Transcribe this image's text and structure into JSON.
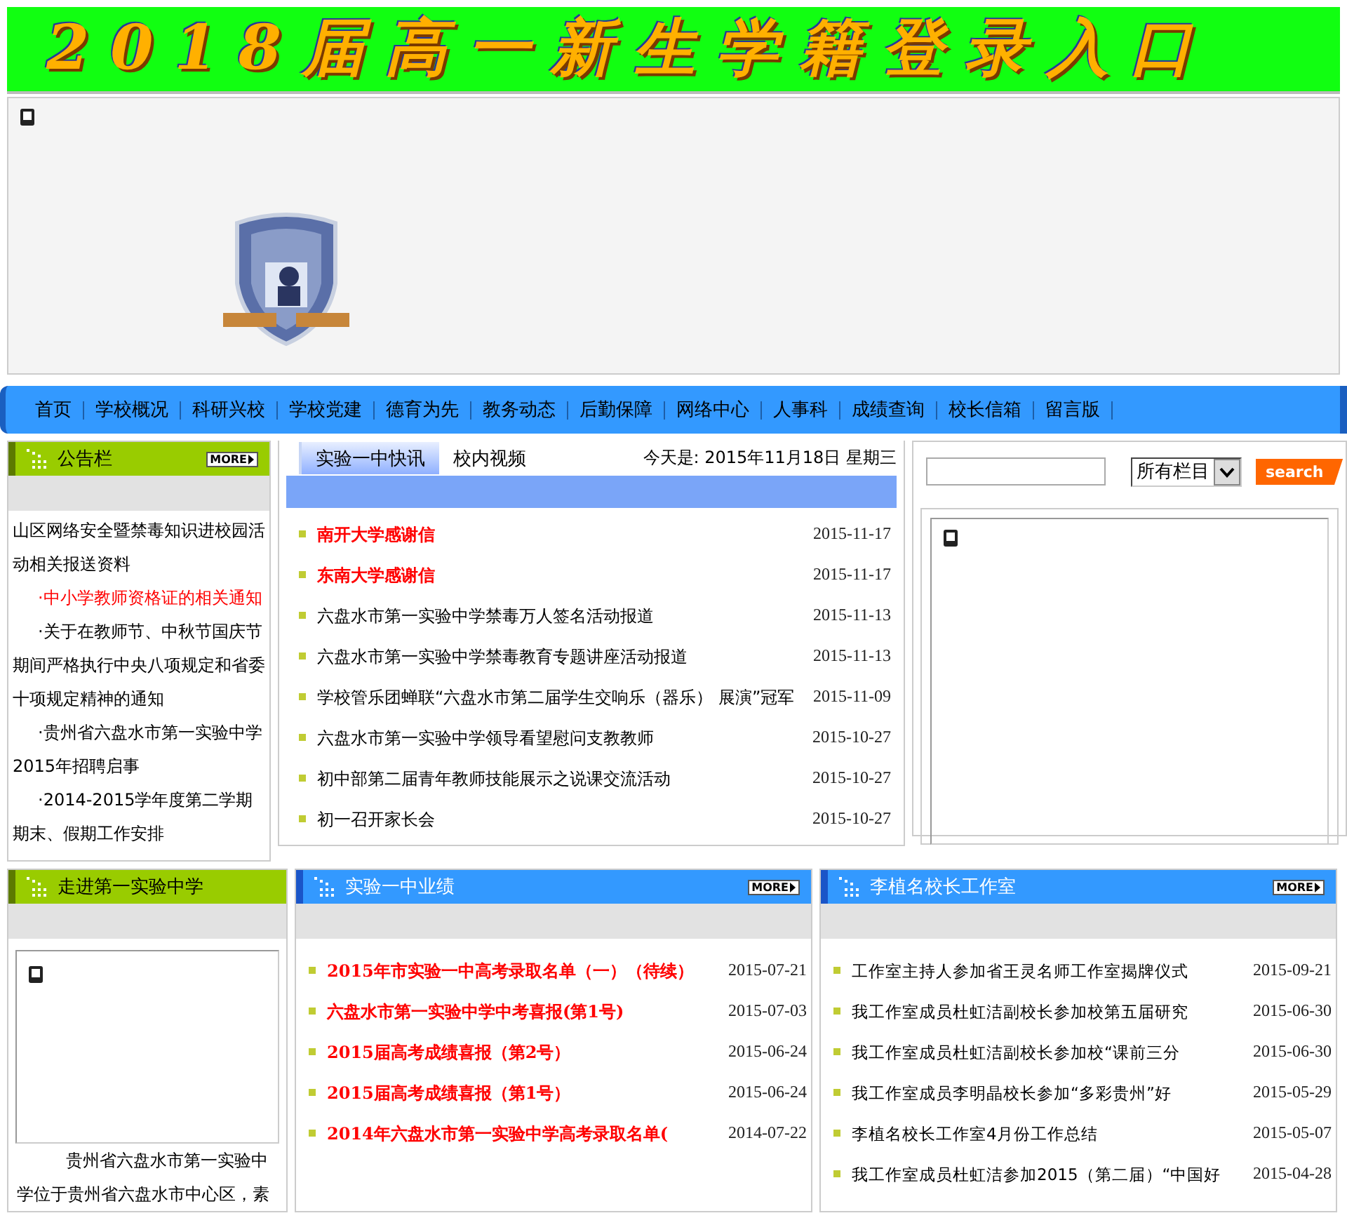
{
  "banner": {
    "title": "2018届高一新生学籍登录入口"
  },
  "nav": [
    "首页",
    "学校概况",
    "科研兴校",
    "学校党建",
    "德育为先",
    "教务动态",
    "后勤保障",
    "网络中心",
    "人事科",
    "成绩查询",
    "校长信箱",
    "留言版"
  ],
  "notice": {
    "title": "公告栏",
    "more": "MORE",
    "items": [
      {
        "text": "山区网络安全暨禁毒知识进校园活动相关报送资料",
        "highlighted": false
      },
      {
        "text": "·中小学教师资格证的相关通知",
        "highlighted": true
      },
      {
        "text": "·关于在教师节、中秋节国庆节期间严格执行中央八项规定和省委十项规定精神的通知",
        "highlighted": false
      },
      {
        "text": "·贵州省六盘水市第一实验中学2015年招聘启事",
        "highlighted": false
      },
      {
        "text": "·2014-2015学年度第二学期期末、假期工作安排",
        "highlighted": false
      }
    ]
  },
  "news": {
    "tabs": [
      {
        "label": "实验一中快讯",
        "selected": true
      },
      {
        "label": "校内视频",
        "selected": false
      }
    ],
    "today": "今天是: 2015年11月18日  星期三",
    "items": [
      {
        "title": "南开大学感谢信",
        "date": "2015-11-17",
        "highlighted": true
      },
      {
        "title": "东南大学感谢信",
        "date": "2015-11-17",
        "highlighted": true
      },
      {
        "title": "六盘水市第一实验中学禁毒万人签名活动报道",
        "date": "2015-11-13",
        "highlighted": false
      },
      {
        "title": "六盘水市第一实验中学禁毒教育专题讲座活动报道",
        "date": "2015-11-13",
        "highlighted": false
      },
      {
        "title": "学校管乐团蝉联“六盘水市第二届学生交响乐（器乐） 展演”冠军",
        "date": "2015-11-09",
        "highlighted": false
      },
      {
        "title": "六盘水市第一实验中学领导看望慰问支教教师",
        "date": "2015-10-27",
        "highlighted": false
      },
      {
        "title": "初中部第二届青年教师技能展示之说课交流活动",
        "date": "2015-10-27",
        "highlighted": false
      },
      {
        "title": "初一召开家长会",
        "date": "2015-10-27",
        "highlighted": false
      }
    ]
  },
  "search": {
    "select": "所有栏目",
    "button": "search"
  },
  "about": {
    "title": "走进第一实验中学",
    "text": "贵州省六盘水市第一实验中学位于贵州省六盘水市中心区，素"
  },
  "achievements": {
    "title": "实验一中业绩",
    "more": "MORE",
    "items": [
      {
        "title": "2015年市实验一中高考录取名单（一）（待续）",
        "date": "2015-07-21",
        "highlighted": true
      },
      {
        "title": "六盘水市第一实验中学中考喜报(第1号)",
        "date": "2015-07-03",
        "highlighted": true
      },
      {
        "title": "2015届高考成绩喜报（第2号）",
        "date": "2015-06-24",
        "highlighted": true
      },
      {
        "title": "2015届高考成绩喜报（第1号）",
        "date": "2015-06-24",
        "highlighted": true
      },
      {
        "title": "2014年六盘水市第一实验中学高考录取名单(",
        "date": "2014-07-22",
        "highlighted": true
      }
    ]
  },
  "studio": {
    "title": "李植名校长工作室",
    "more": "MORE",
    "items": [
      {
        "title": "工作室主持人参加省王灵名师工作室揭牌仪式",
        "date": "2015-09-21",
        "highlighted": false
      },
      {
        "title": "我工作室成员杜虹洁副校长参加校第五届研究",
        "date": "2015-06-30",
        "highlighted": false
      },
      {
        "title": "我工作室成员杜虹洁副校长参加校“课前三分",
        "date": "2015-06-30",
        "highlighted": false
      },
      {
        "title": "我工作室成员李明晶校长参加“多彩贵州”好",
        "date": "2015-05-29",
        "highlighted": false
      },
      {
        "title": "李植名校长工作室4月份工作总结",
        "date": "2015-05-07",
        "highlighted": false
      },
      {
        "title": "我工作室成员杜虹洁参加2015（第二届）“中国好",
        "date": "2015-04-28",
        "highlighted": false
      }
    ]
  }
}
